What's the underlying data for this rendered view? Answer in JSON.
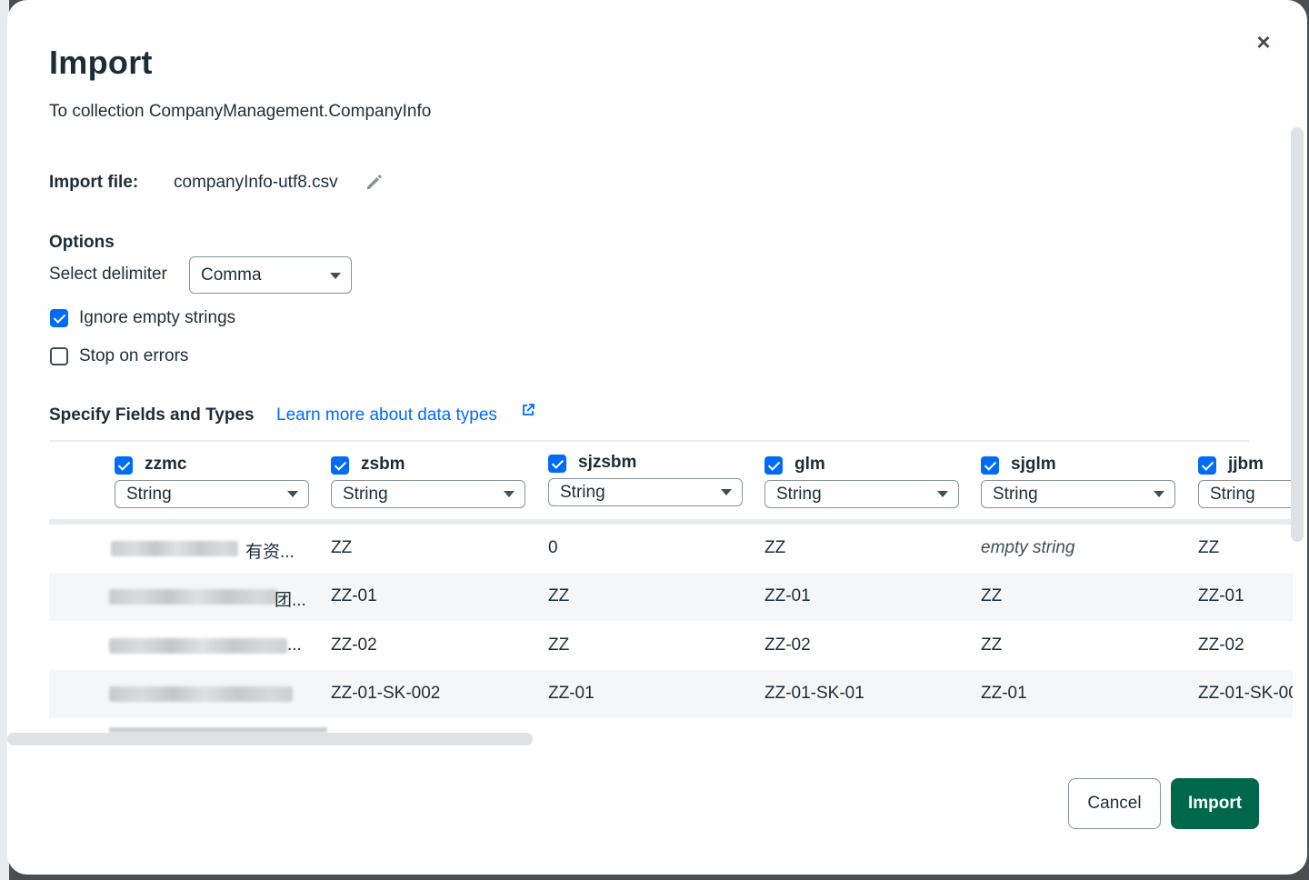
{
  "dialog": {
    "title": "Import",
    "subtitle": "To collection CompanyManagement.CompanyInfo",
    "close_icon": "close-icon"
  },
  "import_file": {
    "label": "Import file:",
    "filename": "companyInfo-utf8.csv",
    "edit_icon": "pencil-icon"
  },
  "options": {
    "heading": "Options",
    "delimiter_label": "Select delimiter",
    "delimiter_value": "Comma",
    "ignore_empty": {
      "label": "Ignore empty strings",
      "checked": true
    },
    "stop_on_errors": {
      "label": "Stop on errors",
      "checked": false
    }
  },
  "fields_section": {
    "heading": "Specify Fields and Types",
    "link_text": "Learn more about data types",
    "link_icon": "external-link-icon"
  },
  "columns": [
    {
      "name": "zzmc",
      "type": "String",
      "checked": true
    },
    {
      "name": "zsbm",
      "type": "String",
      "checked": true
    },
    {
      "name": "sjzsbm",
      "type": "String",
      "checked": true
    },
    {
      "name": "glm",
      "type": "String",
      "checked": true
    },
    {
      "name": "sjglm",
      "type": "String",
      "checked": true
    },
    {
      "name": "jjbm",
      "type": "String",
      "checked": true
    }
  ],
  "rows": [
    [
      "有资...",
      "ZZ",
      "0",
      "ZZ",
      "empty string",
      "ZZ"
    ],
    [
      "团...",
      "ZZ-01",
      "ZZ",
      "ZZ-01",
      "ZZ",
      "ZZ-01"
    ],
    [
      "...",
      "ZZ-02",
      "ZZ",
      "ZZ-02",
      "ZZ",
      "ZZ-02"
    ],
    [
      "",
      "ZZ-01-SK-002",
      "ZZ-01",
      "ZZ-01-SK-01",
      "ZZ-01",
      "ZZ-01-SK-00"
    ]
  ],
  "buttons": {
    "cancel": "Cancel",
    "import": "Import"
  },
  "colors": {
    "accent_blue": "#016bf8",
    "import_green": "#00684a",
    "text_dark": "#1c2d38"
  }
}
